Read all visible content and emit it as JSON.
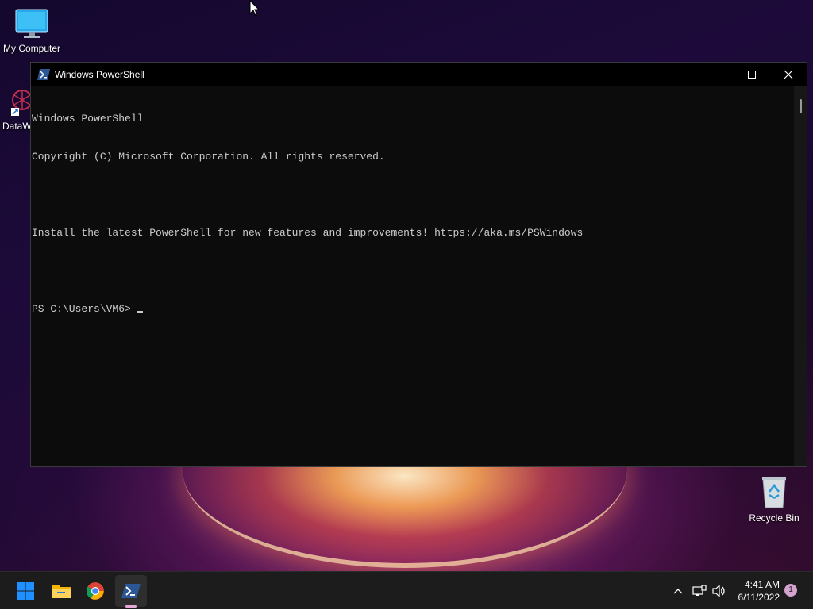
{
  "desktop": {
    "icons": [
      {
        "label": "My Computer"
      },
      {
        "label": "DataW"
      },
      {
        "label": "Recycle Bin"
      }
    ]
  },
  "window": {
    "title": "Windows PowerShell",
    "controls": {
      "minimize": "—",
      "maximize": "☐",
      "close": "✕"
    }
  },
  "console": {
    "lines": [
      "Windows PowerShell",
      "Copyright (C) Microsoft Corporation. All rights reserved.",
      "",
      "Install the latest PowerShell for new features and improvements! https://aka.ms/PSWindows",
      ""
    ],
    "prompt": "PS C:\\Users\\VM6> "
  },
  "taskbar": {
    "pinned": [
      "start-icon",
      "file-explorer-icon",
      "chrome-icon",
      "powershell-icon"
    ],
    "tray": {
      "chevron": "^",
      "time": "4:41 AM",
      "date": "6/11/2022",
      "notifications": "1"
    }
  },
  "colors": {
    "console_bg": "#0c0c0c",
    "console_fg": "#cccccc",
    "taskbar_bg": "#1c1c1c",
    "accent_ps": "#2b5797",
    "start_blue": "#1e90ff"
  }
}
